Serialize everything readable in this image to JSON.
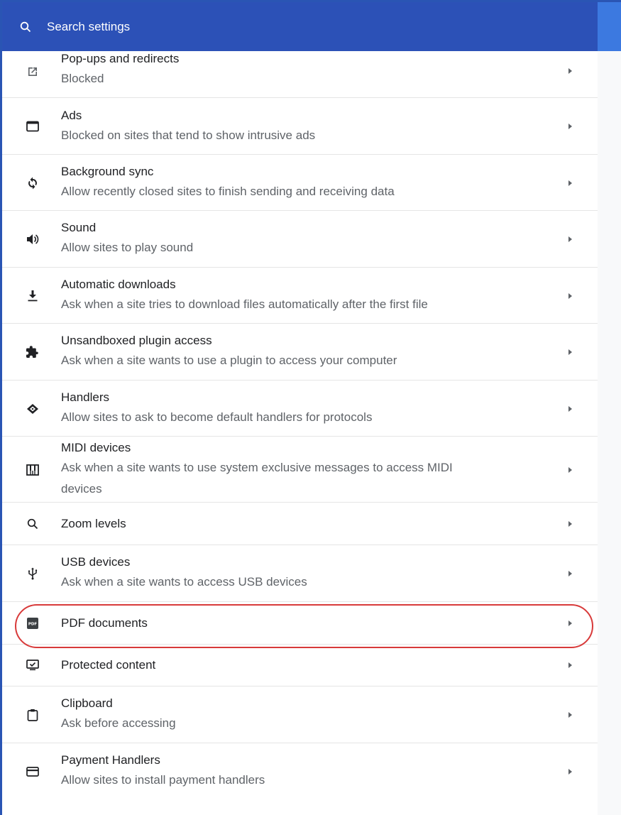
{
  "search": {
    "placeholder": "Search settings"
  },
  "rows": [
    {
      "title": "Pop-ups and redirects",
      "subtitle": "Blocked",
      "icon": "open-in-new-icon"
    },
    {
      "title": "Ads",
      "subtitle": "Blocked on sites that tend to show intrusive ads",
      "icon": "web-asset-icon"
    },
    {
      "title": "Background sync",
      "subtitle": "Allow recently closed sites to finish sending and receiving data",
      "icon": "sync-icon"
    },
    {
      "title": "Sound",
      "subtitle": "Allow sites to play sound",
      "icon": "volume-icon"
    },
    {
      "title": "Automatic downloads",
      "subtitle": "Ask when a site tries to download files automatically after the first file",
      "icon": "download-icon"
    },
    {
      "title": "Unsandboxed plugin access",
      "subtitle": "Ask when a site wants to use a plugin to access your computer",
      "icon": "puzzle-piece-icon"
    },
    {
      "title": "Handlers",
      "subtitle": "Allow sites to ask to become default handlers for protocols",
      "icon": "handler-icon"
    },
    {
      "title": "MIDI devices",
      "subtitle": "Ask when a site wants to use system exclusive messages to access MIDI",
      "subtitle2": "devices",
      "icon": "piano-icon"
    },
    {
      "title": "Zoom levels",
      "icon": "zoom-icon"
    },
    {
      "title": "USB devices",
      "subtitle": "Ask when a site wants to access USB devices",
      "icon": "usb-icon"
    },
    {
      "title": "PDF documents",
      "icon": "pdf-icon"
    },
    {
      "title": "Protected content",
      "icon": "protected-content-icon"
    },
    {
      "title": "Clipboard",
      "subtitle": "Ask before accessing",
      "icon": "clipboard-icon"
    },
    {
      "title": "Payment Handlers",
      "subtitle": "Allow sites to install payment handlers",
      "icon": "payment-icon"
    }
  ],
  "colors": {
    "header": "#2c51b7",
    "highlight": "#d83a3a"
  }
}
